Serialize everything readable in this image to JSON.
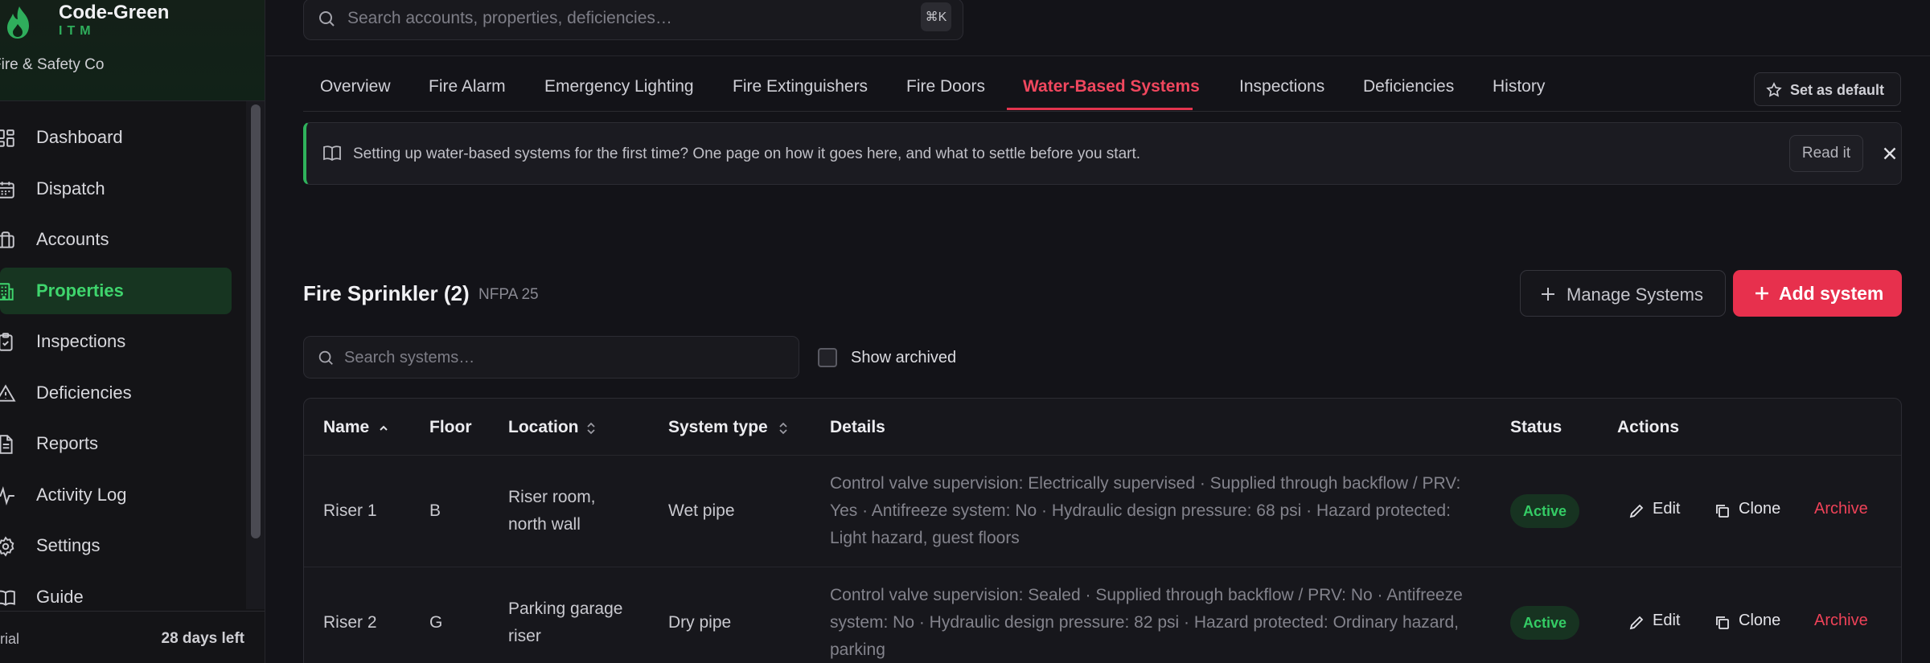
{
  "brand": {
    "name": "Code-Green",
    "sub": "ITM",
    "company": "Fire & Safety Co",
    "accent": "#2fae5c"
  },
  "sidebar": {
    "items": [
      {
        "label": "Dashboard",
        "icon": "dashboard-icon",
        "active": false
      },
      {
        "label": "Dispatch",
        "icon": "calendar-icon",
        "active": false
      },
      {
        "label": "Accounts",
        "icon": "briefcase-icon",
        "active": false
      },
      {
        "label": "Properties",
        "icon": "building-icon",
        "active": true
      },
      {
        "label": "Inspections",
        "icon": "clipboard-check-icon",
        "active": false
      },
      {
        "label": "Deficiencies",
        "icon": "warning-icon",
        "active": false
      },
      {
        "label": "Reports",
        "icon": "document-icon",
        "active": false
      },
      {
        "label": "Activity Log",
        "icon": "activity-icon",
        "active": false
      },
      {
        "label": "Settings",
        "icon": "gear-icon",
        "active": false
      },
      {
        "label": "Guide",
        "icon": "book-icon",
        "active": false
      }
    ],
    "trial_text": "rial",
    "days_left": "28 days left"
  },
  "search": {
    "placeholder": "Search accounts, properties, deficiencies…",
    "shortcut": "⌘K"
  },
  "tabs": [
    {
      "label": "Overview",
      "active": false
    },
    {
      "label": "Fire Alarm",
      "active": false
    },
    {
      "label": "Emergency Lighting",
      "active": false
    },
    {
      "label": "Fire Extinguishers",
      "active": false
    },
    {
      "label": "Fire Doors",
      "active": false
    },
    {
      "label": "Water-Based Systems",
      "active": true
    },
    {
      "label": "Inspections",
      "active": false
    },
    {
      "label": "Deficiencies",
      "active": false
    },
    {
      "label": "History",
      "active": false
    }
  ],
  "set_default_label": "Set as default",
  "banner": {
    "text": "Setting up water-based systems for the first time? One page on how it goes here, and what to settle before you start.",
    "button": "Read it"
  },
  "section": {
    "title": "Fire Sprinkler (2)",
    "standard": "NFPA 25",
    "manage_label": "Manage Systems",
    "add_label": "Add system"
  },
  "filters": {
    "search_placeholder": "Search systems…",
    "show_archived_label": "Show archived",
    "show_archived": false
  },
  "table": {
    "columns": [
      "Name",
      "Floor",
      "Location",
      "System type",
      "Details",
      "Status",
      "Actions"
    ],
    "rows": [
      {
        "name": "Riser 1",
        "floor": "B",
        "location": "Riser room, north wall",
        "system_type": "Wet pipe",
        "details": "Control valve supervision: Electrically supervised · Supplied through backflow / PRV: Yes · Antifreeze system: No · Hydraulic design pressure: 68 psi · Hazard protected: Light hazard, guest floors",
        "status": "Active"
      },
      {
        "name": "Riser 2",
        "floor": "G",
        "location": "Parking garage riser",
        "system_type": "Dry pipe",
        "details": "Control valve supervision: Sealed · Supplied through backflow / PRV: No · Antifreeze system: No · Hydraulic design pressure: 82 psi · Hazard protected: Ordinary hazard, parking",
        "status": "Active"
      }
    ],
    "actions": {
      "edit": "Edit",
      "clone": "Clone",
      "archive": "Archive"
    }
  }
}
